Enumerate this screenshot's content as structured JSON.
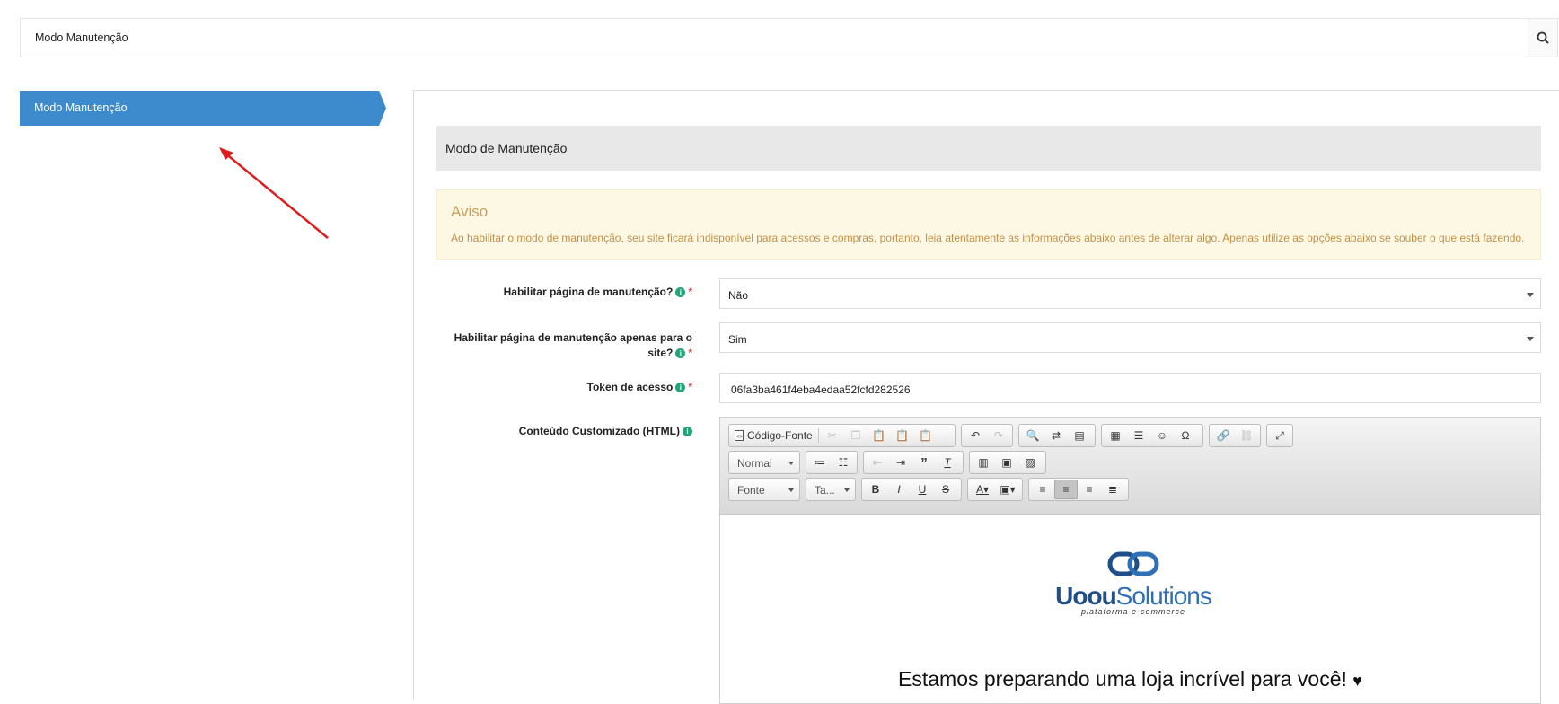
{
  "topbar": {
    "title": "Modo Manutenção",
    "search_icon": "search-icon"
  },
  "sidebar": {
    "items": [
      {
        "label": "Modo Manutenção",
        "active": true
      }
    ]
  },
  "section": {
    "title": "Modo de Manutenção"
  },
  "alert": {
    "title": "Aviso",
    "text": "Ao habilitar o modo de manutenção, seu site ficará indisponível para acessos e compras, portanto, leia atentamente as informações abaixo antes de alterar algo. Apenas utilize as opções abaixo se souber o que está fazendo."
  },
  "form": {
    "enable_maintenance": {
      "label": "Habilitar página de manutenção?",
      "value": "Não",
      "required": "*"
    },
    "enable_site_only": {
      "label_line1": "Habilitar página de manutenção apenas para o",
      "label_line2": "site?",
      "value": "Sim",
      "required": "*"
    },
    "token": {
      "label": "Token de acesso",
      "value": "06fa3ba461f4eba4edaa52fcfd282526",
      "required": "*"
    },
    "custom_content": {
      "label": "Conteúdo Customizado (HTML)"
    }
  },
  "editor": {
    "source_label": "Código-Fonte",
    "format_combo": "Normal",
    "font_combo": "Fonte",
    "size_combo": "Ta...",
    "content": {
      "logo_brand_bold": "Uoou",
      "logo_brand_light": "Solutions",
      "logo_tagline": "plataforma e-commerce",
      "headline": "Estamos preparando uma loja incrível para você!",
      "heart": "♥"
    }
  },
  "colors": {
    "accent": "#3d8bcd",
    "alert_bg": "#fcf8e3",
    "info_icon": "#27a37a",
    "required": "#d9534f"
  }
}
